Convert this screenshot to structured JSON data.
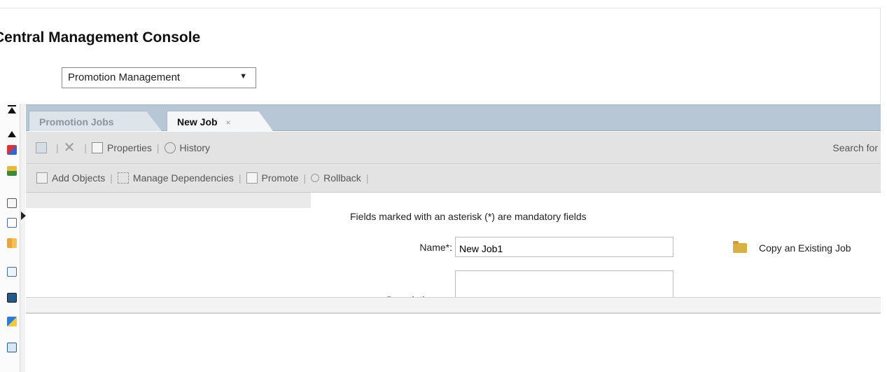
{
  "app": {
    "title": "Central Management Console",
    "app_selector": "Promotion Management"
  },
  "tabs": [
    {
      "label": "Promotion Jobs",
      "active": false
    },
    {
      "label": "New Job",
      "active": true,
      "close_icon": "×"
    }
  ],
  "toolbar1": {
    "properties_label": "Properties",
    "history_label": "History",
    "search_label": "Search for"
  },
  "toolbar2": {
    "add_objects_label": "Add Objects",
    "manage_dependencies_label": "Manage Dependencies",
    "promote_label": "Promote",
    "rollback_label": "Rollback"
  },
  "form": {
    "hint": "Fields marked with an asterisk (*) are mandatory fields",
    "name_label": "Name*:",
    "name_value": "New Job1",
    "description_label": "Description:",
    "copy_existing_label": "Copy an Existing Job"
  },
  "icons": {
    "rail": [
      "collapse-top-icon",
      "up-arrow-icon",
      "favorites-icon",
      "users-icon",
      "folder-settings-icon",
      "clipboard-icon",
      "grid-icon",
      "document-check-icon",
      "monitor-icon",
      "deploy-icon",
      "expand-icon"
    ]
  },
  "colors": {
    "tabstrip": "#b8c7d6",
    "toolbar": "#e3e3e3",
    "folder": "#d9b043"
  }
}
